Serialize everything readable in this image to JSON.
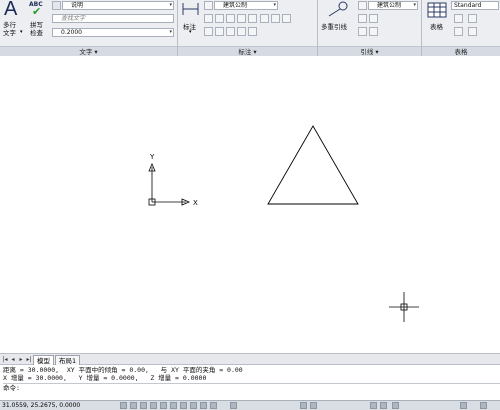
{
  "ribbon": {
    "text_panel": {
      "title": "文字",
      "mtext_label": "多行\n文字",
      "mtext_line1": "多行",
      "mtext_line2": "文字",
      "spell_line1": "拼写",
      "spell_line2": "检查",
      "abc": "ABC",
      "style": "说明",
      "find_placeholder": "查找文字",
      "height": "0.2000"
    },
    "dim_panel": {
      "title": "标注",
      "style": "建筑公制",
      "dim_label": "标注"
    },
    "leader_panel": {
      "title": "引线",
      "style": "建筑公制",
      "multileader": "多重引线"
    },
    "table_panel": {
      "title": "表格",
      "style": "Standard",
      "table_label": "表格"
    }
  },
  "canvas": {
    "ucs_x": "X",
    "ucs_y": "Y"
  },
  "tabs": {
    "model": "模型",
    "layout1": "布局1"
  },
  "command": {
    "line1": "距离 = 30.0000,  XY 平面中的倾角 = 0.00,   与 XY 平面的夹角 = 0.00",
    "line2": "X 增量 = 30.0000,   Y 增量 = 0.0000,   Z 增量 = 0.0000",
    "prompt": "命令:"
  },
  "status": {
    "coords": "31.0559,  25.2675,  0.0000"
  },
  "colors": {
    "ribbon_bg": "#eceef2",
    "panel_title_bg": "#d6dbe3",
    "triangle": "#000000"
  }
}
